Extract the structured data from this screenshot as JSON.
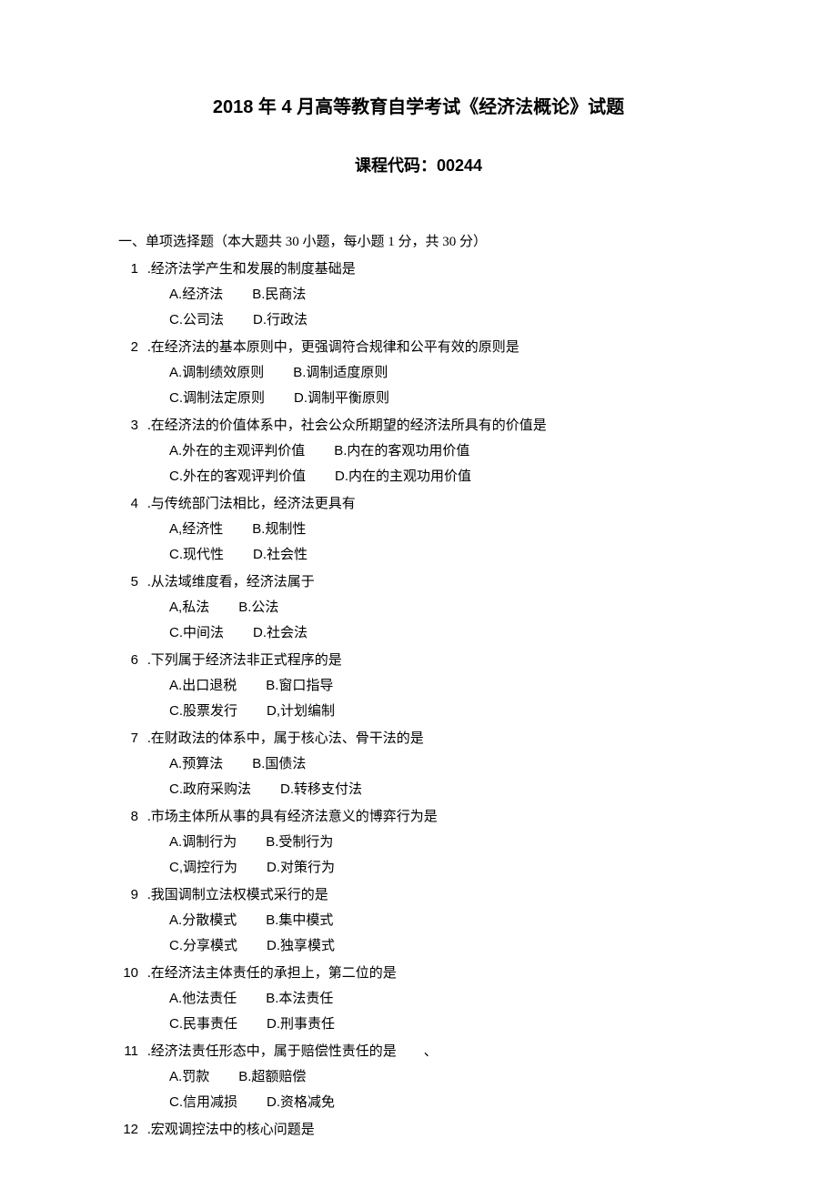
{
  "title": "2018 年 4 月高等教育自学考试《经济法概论》试题",
  "subtitle": "课程代码：00244",
  "section1_heading": "一、单项选择题（本大题共 30 小题，每小题 1 分，共 30 分）",
  "questions": [
    {
      "num": "1",
      "stem": ".经济法学产生和发展的制度基础是",
      "rows": [
        [
          {
            "label": "A.",
            "text": "经济法"
          },
          {
            "label": "B.",
            "text": "民商法"
          }
        ],
        [
          {
            "label": "C.",
            "text": "公司法"
          },
          {
            "label": "D.",
            "text": "行政法"
          }
        ]
      ]
    },
    {
      "num": "2",
      "stem": ".在经济法的基本原则中，更强调符合规律和公平有效的原则是",
      "rows": [
        [
          {
            "label": "A.",
            "text": "调制绩效原则"
          },
          {
            "label": "B.",
            "text": "调制适度原则"
          }
        ],
        [
          {
            "label": "C.",
            "text": "调制法定原则"
          },
          {
            "label": "D.",
            "text": "调制平衡原则"
          }
        ]
      ]
    },
    {
      "num": "3",
      "stem": ".在经济法的价值体系中，社会公众所期望的经济法所具有的价值是",
      "rows": [
        [
          {
            "label": "A.",
            "text": "外在的主观评判价值"
          },
          {
            "label": "B.",
            "text": "内在的客观功用价值"
          }
        ],
        [
          {
            "label": "C.",
            "text": "外在的客观评判价值"
          },
          {
            "label": "D.",
            "text": "内在的主观功用价值"
          }
        ]
      ]
    },
    {
      "num": "4",
      "stem": ".与传统部门法相比，经济法更具有",
      "rows": [
        [
          {
            "label": "A,",
            "text": "经济性"
          },
          {
            "label": "B.",
            "text": "规制性"
          }
        ],
        [
          {
            "label": "C.",
            "text": "现代性"
          },
          {
            "label": "D.",
            "text": "社会性"
          }
        ]
      ]
    },
    {
      "num": "5",
      "stem": ".从法域维度看，经济法属于",
      "rows": [
        [
          {
            "label": "A,",
            "text": "私法"
          },
          {
            "label": "B.",
            "text": "公法"
          }
        ],
        [
          {
            "label": "C.",
            "text": "中间法"
          },
          {
            "label": "D.",
            "text": "社会法"
          }
        ]
      ]
    },
    {
      "num": "6",
      "stem": ".下列属于经济法非正式程序的是",
      "rows": [
        [
          {
            "label": "A.",
            "text": "出口退税"
          },
          {
            "label": "B.",
            "text": "窗口指导"
          }
        ],
        [
          {
            "label": "C.",
            "text": "股票发行"
          },
          {
            "label": "D,",
            "text": "计划编制"
          }
        ]
      ]
    },
    {
      "num": "7",
      "stem": ".在财政法的体系中，属于核心法、骨干法的是",
      "rows": [
        [
          {
            "label": "A.",
            "text": "预算法"
          },
          {
            "label": "B.",
            "text": "国债法"
          }
        ],
        [
          {
            "label": "C.",
            "text": "政府采购法"
          },
          {
            "label": "D.",
            "text": "转移支付法"
          }
        ]
      ]
    },
    {
      "num": "8",
      "stem": ".市场主体所从事的具有经济法意义的博弈行为是",
      "rows": [
        [
          {
            "label": "A.",
            "text": "调制行为"
          },
          {
            "label": "B.",
            "text": "受制行为"
          }
        ],
        [
          {
            "label": "C,",
            "text": "调控行为"
          },
          {
            "label": "D.",
            "text": "对策行为"
          }
        ]
      ]
    },
    {
      "num": "9",
      "stem": ".我国调制立法权模式采行的是",
      "rows": [
        [
          {
            "label": "A.",
            "text": "分散模式"
          },
          {
            "label": "B.",
            "text": "集中模式"
          }
        ],
        [
          {
            "label": "C.",
            "text": "分享模式"
          },
          {
            "label": "D.",
            "text": "独享模式"
          }
        ]
      ]
    },
    {
      "num": "10",
      "stem": ".在经济法主体责任的承担上，第二位的是",
      "rows": [
        [
          {
            "label": "A.",
            "text": "他法责任"
          },
          {
            "label": "B.",
            "text": "本法责任"
          }
        ],
        [
          {
            "label": "C.",
            "text": "民事责任"
          },
          {
            "label": "D.",
            "text": "刑事责任"
          }
        ]
      ]
    },
    {
      "num": "11",
      "stem": ".经济法责任形态中，属于赔偿性责任的是　　、",
      "rows": [
        [
          {
            "label": "A.",
            "text": "罚款"
          },
          {
            "label": "B.",
            "text": "超额赔偿"
          }
        ],
        [
          {
            "label": "C.",
            "text": "信用减损"
          },
          {
            "label": "D.",
            "text": "资格减免"
          }
        ]
      ]
    },
    {
      "num": "12",
      "stem": ".宏观调控法中的核心问题是",
      "rows": []
    }
  ]
}
